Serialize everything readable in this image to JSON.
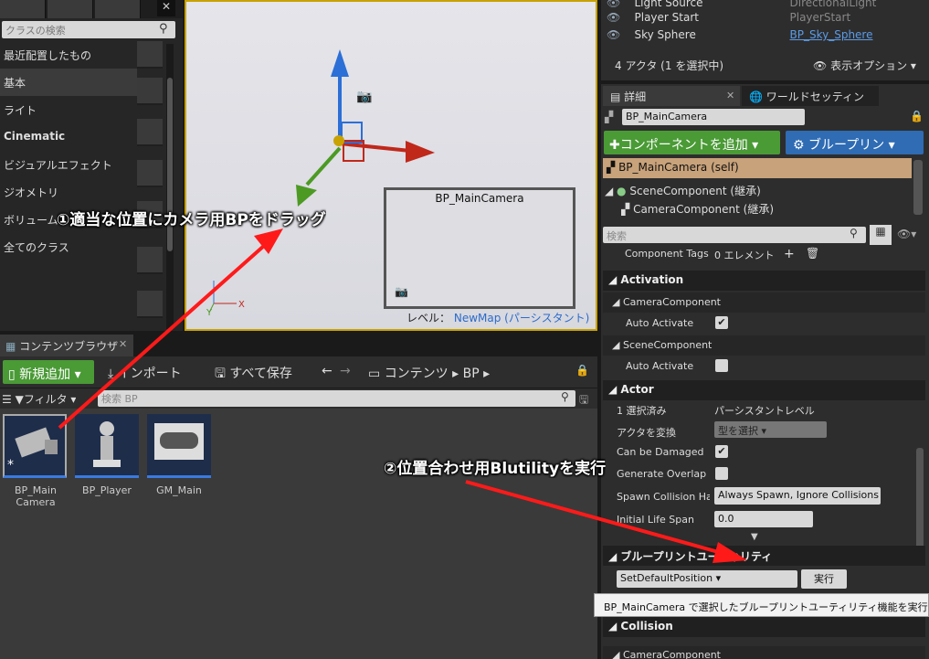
{
  "class_panel": {
    "search_placeholder": "クラスの検索",
    "categories": [
      "最近配置したもの",
      "基本",
      "ライト",
      "Cinematic",
      "ビジュアルエフェクト",
      "ジオメトリ",
      "ボリューム",
      "全てのクラス"
    ]
  },
  "viewport": {
    "preview_title": "BP_MainCamera",
    "level_label": "レベル：",
    "level_name": "NewMap (パーシスタント)"
  },
  "content_browser": {
    "tab_label": "コンテンツブラウザ",
    "add_new": "新規追加",
    "import": "インポート",
    "save_all": "すべて保存",
    "path": [
      "コンテンツ",
      "BP"
    ],
    "filter": "フィルタ",
    "search_placeholder": "検索 BP",
    "assets": [
      {
        "label": "BP_Main\nCamera"
      },
      {
        "label": "BP_Player"
      },
      {
        "label": "GM_Main"
      }
    ]
  },
  "outliner": {
    "rows": [
      {
        "name": "Light Source",
        "type": "DirectionalLight"
      },
      {
        "name": "Player Start",
        "type": "PlayerStart"
      },
      {
        "name": "Sky Sphere",
        "type": "BP_Sky_Sphere"
      }
    ],
    "status": "4 アクタ (1 を選択中)",
    "view_options": "表示オプション"
  },
  "details": {
    "tab_details": "詳細",
    "tab_world": "ワールドセッティン",
    "actor_name": "BP_MainCamera",
    "add_component": "コンポーネントを追加",
    "blueprint": "ブループリン",
    "components": [
      "BP_MainCamera (self)",
      "SceneComponent (継承)",
      "CameraComponent (継承)"
    ],
    "search_placeholder": "検索",
    "component_tags_label": "Component Tags",
    "component_tags_value": "0 エレメント",
    "sections": {
      "activation": "Activation",
      "camera_component": "CameraComponent",
      "scene_component": "SceneComponent",
      "auto_activate": "Auto Activate",
      "actor": "Actor",
      "selected_label": "1 選択済み",
      "selected_value": "パーシスタントレベル",
      "convert_actor": "アクタを変換",
      "select_type": "型を選択",
      "can_be_damaged": "Can be Damaged",
      "generate_overlap": "Generate Overlap Ev",
      "spawn_collision": "Spawn Collision Han",
      "spawn_collision_value": "Always Spawn, Ignore Collisions",
      "initial_life_span": "Initial Life Span",
      "initial_life_value": "0.0",
      "blutility": "ブループリントユーティリティ",
      "blutility_func": "SetDefaultPosition",
      "run": "実行",
      "collision": "Collision",
      "camera_component2": "CameraComponent"
    }
  },
  "tooltip": "BP_MainCamera で選択したブループリントユーティリティ機能を実行",
  "annotations": {
    "step1": "①適当な位置にカメラ用BPをドラッグ",
    "step2": "②位置合わせ用Blutilityを実行"
  },
  "colors": {
    "arrow": "#ff1a1a",
    "accent_green": "#4a9a36",
    "accent_blue": "#2f6cb4",
    "selection": "#c8a27a"
  }
}
